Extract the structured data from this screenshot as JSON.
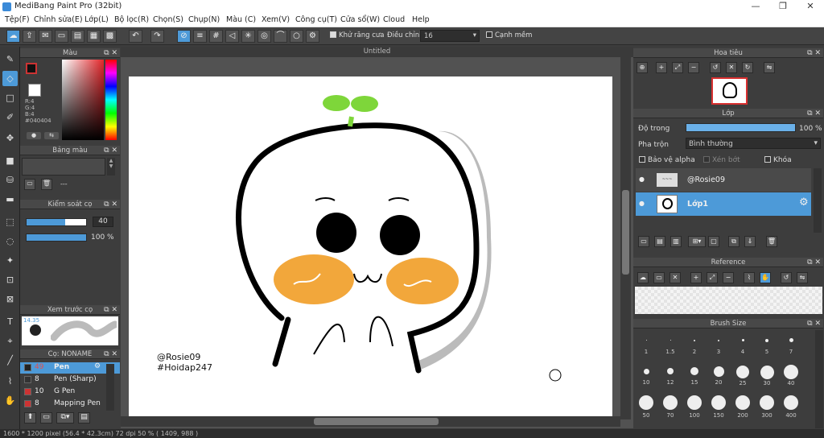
{
  "app": {
    "title": "MediBang Paint Pro (32bit)"
  },
  "menu": [
    "Tệp(F)",
    "Chỉnh sửa(E)",
    "Lớp(L)",
    "Bộ lọc(R)",
    "Chọn(S)",
    "Chụp(N)",
    "Màu (C)",
    "Xem(V)",
    "Công cụ(T)",
    "Cửa sổ(W)",
    "Cloud",
    "Help"
  ],
  "toolbar": {
    "antialias_label": "Khử răng cưa",
    "adjust_label": "Điều chỉnh",
    "adjust_value": "16",
    "edge_label": "Cạnh mềm"
  },
  "color_panel": {
    "title": "Màu",
    "r": "R:4",
    "g": "G:4",
    "b": "B:4",
    "hex": "#040404"
  },
  "palette_panel": {
    "title": "Bảng màu",
    "value": "---"
  },
  "brush_control": {
    "title": "Kiểm soát cọ",
    "size": "40",
    "opacity": "100 %"
  },
  "brush_preview": {
    "title": "Xem trước cọ",
    "value": "14.35"
  },
  "brush_list": {
    "title": "Cọ: NONAME",
    "items": [
      {
        "size": "49",
        "name": "Pen",
        "color": "#cc3333"
      },
      {
        "size": "8",
        "name": "Pen (Sharp)",
        "color": "#333333"
      },
      {
        "size": "10",
        "name": "G Pen",
        "color": "#cc3333"
      },
      {
        "size": "8",
        "name": "Mapping Pen",
        "color": "#cc3333"
      }
    ]
  },
  "canvas": {
    "tab": "Untitled",
    "watermark1": "@Rosie09",
    "watermark2": "#Hoidap247"
  },
  "navigator": {
    "title": "Hoa tiêu"
  },
  "layer_panel": {
    "title": "Lớp",
    "opacity_label": "Độ trong",
    "opacity_value": "100 %",
    "blend_label": "Pha trộn",
    "blend_value": "Bình thường",
    "protect_alpha": "Bảo vệ alpha",
    "clip": "Xén bớt",
    "lock": "Khóa",
    "layers": [
      {
        "name": "@Rosie09"
      },
      {
        "name": "Lớp1"
      }
    ]
  },
  "reference_panel": {
    "title": "Reference"
  },
  "brush_size_panel": {
    "title": "Brush Size",
    "sizes": [
      "1",
      "1.5",
      "2",
      "3",
      "4",
      "5",
      "7",
      "10",
      "12",
      "15",
      "20",
      "25",
      "30",
      "40",
      "50",
      "70",
      "100",
      "150",
      "200",
      "300",
      "400"
    ]
  },
  "status": {
    "text": "1600 * 1200 pixel   (56.4 * 42.3cm)   72 dpi   50 %   ( 1409, 988 )"
  },
  "colors": {
    "accent": "#4d9ad8",
    "sprout": "#7ed63a",
    "cheek": "#f2a73b"
  }
}
